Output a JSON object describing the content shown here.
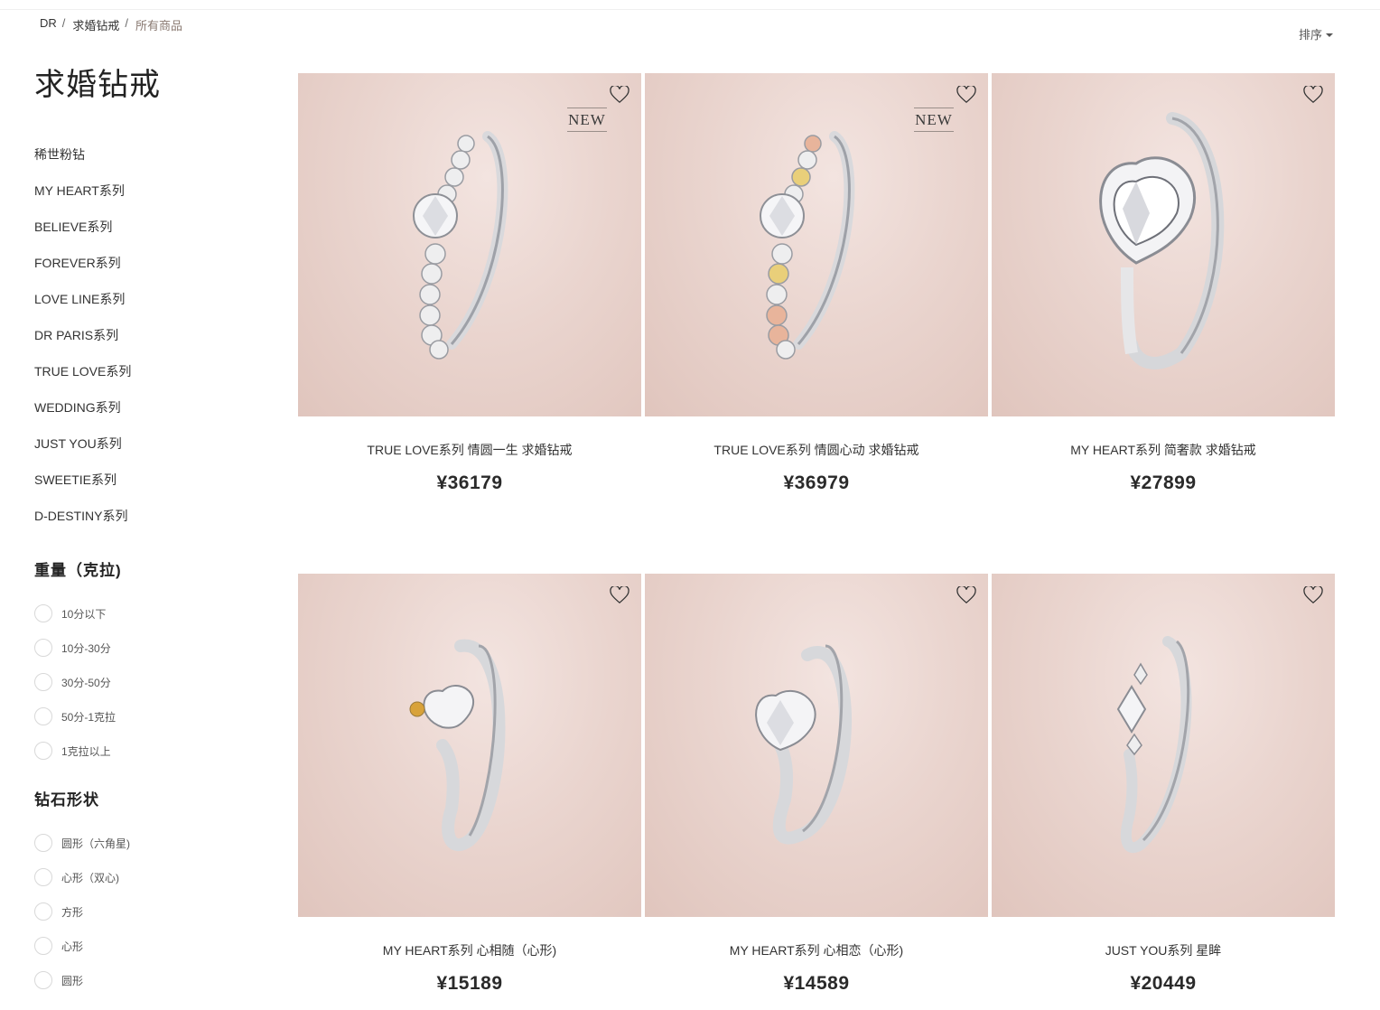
{
  "breadcrumb": {
    "items": [
      "DR",
      "求婚钻戒",
      "所有商品"
    ],
    "separator": "/"
  },
  "sort": {
    "label": "排序"
  },
  "page_title": "求婚钻戒",
  "series": [
    "稀世粉钻",
    "MY HEART系列",
    "BELIEVE系列",
    "FOREVER系列",
    "LOVE LINE系列",
    "DR PARIS系列",
    "TRUE LOVE系列",
    "WEDDING系列",
    "JUST YOU系列",
    "SWEETIE系列",
    "D-DESTINY系列"
  ],
  "filters": {
    "weight": {
      "title": "重量（克拉)",
      "options": [
        "10分以下",
        "10分-30分",
        "30分-50分",
        "50分-1克拉",
        "1克拉以上"
      ]
    },
    "shape": {
      "title": "钻石形状",
      "options": [
        "圆形（六角星)",
        "心形（双心)",
        "方形",
        "心形",
        "圆形"
      ]
    }
  },
  "products": [
    {
      "name": "TRUE LOVE系列 情圆一生 求婚钻戒",
      "price": "¥36179",
      "badge": "NEW",
      "icon": "solitaire-round-ring-icon"
    },
    {
      "name": "TRUE LOVE系列 情圆心动 求婚钻戒",
      "price": "¥36979",
      "badge": "NEW",
      "icon": "solitaire-round-ring-gold-icon"
    },
    {
      "name": "MY HEART系列 简奢款 求婚钻戒",
      "price": "¥27899",
      "badge": "",
      "icon": "halo-heart-ring-icon"
    },
    {
      "name": "MY HEART系列 心相随（心形)",
      "price": "¥15189",
      "badge": "",
      "icon": "heart-ring-yellow-accent-icon"
    },
    {
      "name": "MY HEART系列 心相恋（心形)",
      "price": "¥14589",
      "badge": "",
      "icon": "heart-solitaire-ring-icon"
    },
    {
      "name": "JUST YOU系列 星眸",
      "price": "¥20449",
      "badge": "",
      "icon": "three-stone-ring-icon"
    }
  ],
  "colors": {
    "image_bg": "#ead5cf",
    "breadcrumb_current": "#8a7a72",
    "text": "#333333"
  }
}
